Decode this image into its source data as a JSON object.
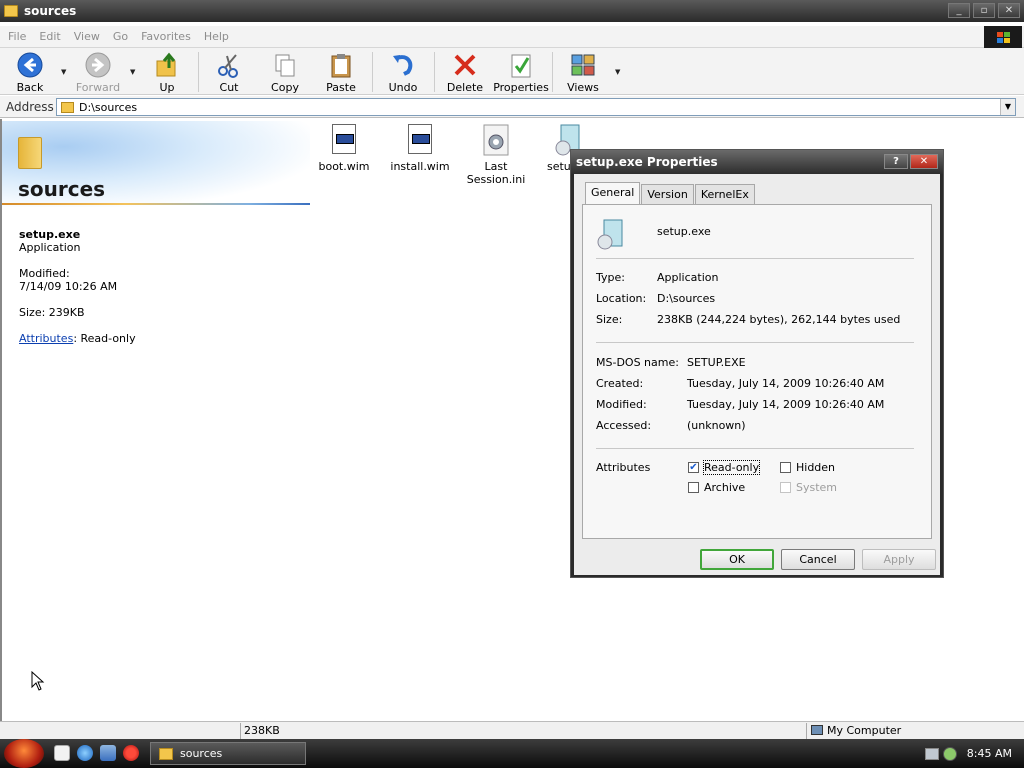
{
  "window": {
    "title": "sources"
  },
  "menu": [
    "File",
    "Edit",
    "View",
    "Go",
    "Favorites",
    "Help"
  ],
  "toolbar": {
    "back": "Back",
    "forward": "Forward",
    "up": "Up",
    "cut": "Cut",
    "copy": "Copy",
    "paste": "Paste",
    "undo": "Undo",
    "delete": "Delete",
    "properties": "Properties",
    "views": "Views"
  },
  "address": {
    "label": "Address",
    "value": "D:\\sources"
  },
  "taskpane": {
    "heading": "sources",
    "name": "setup.exe",
    "type": "Application",
    "modified_label": "Modified:",
    "modified_value": "7/14/09 10:26 AM",
    "size": "Size: 239KB",
    "attributes_link": "Attributes",
    "attributes_value": ": Read-only"
  },
  "files": [
    {
      "name": "boot.wim"
    },
    {
      "name": "install.wim"
    },
    {
      "name_line1": "Last",
      "name_line2": "Session.ini"
    },
    {
      "name": "setup"
    }
  ],
  "statusbar": {
    "size": "238KB",
    "zone": "My Computer"
  },
  "taskbar": {
    "task": "sources",
    "clock": "8:45 AM"
  },
  "dialog": {
    "title": "setup.exe Properties",
    "help_btn": "?",
    "close_btn": "✕",
    "tabs": [
      "General",
      "Version",
      "KernelEx"
    ],
    "filename": "setup.exe",
    "type_label": "Type:",
    "type_value": "Application",
    "location_label": "Location:",
    "location_value": "D:\\sources",
    "size_label": "Size:",
    "size_value": "238KB (244,224 bytes), 262,144 bytes used",
    "msdos_label": "MS-DOS name:",
    "msdos_value": "SETUP.EXE",
    "created_label": "Created:",
    "created_value": "Tuesday, July 14, 2009 10:26:40 AM",
    "modified_label": "Modified:",
    "modified_value": "Tuesday, July 14, 2009 10:26:40 AM",
    "accessed_label": "Accessed:",
    "accessed_value": "(unknown)",
    "attributes_label": "Attributes",
    "readonly": "Read-only",
    "hidden": "Hidden",
    "archive": "Archive",
    "system": "System",
    "readonly_checked": true,
    "hidden_checked": false,
    "archive_checked": false,
    "system_checked": false,
    "ok": "OK",
    "cancel": "Cancel",
    "apply": "Apply"
  }
}
